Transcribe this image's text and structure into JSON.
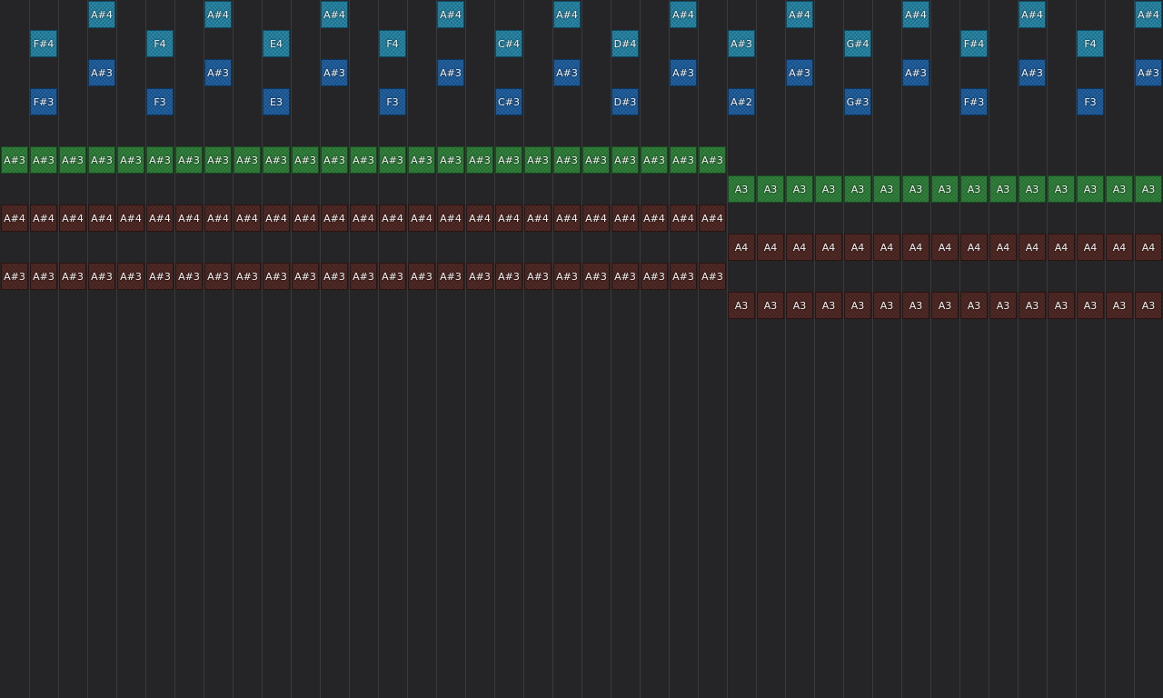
{
  "palette": {
    "background": "#252527",
    "grid_line": "#3a3a3d",
    "lead_high": "#1f7f9f",
    "lead_low": "#1a5a9a",
    "bass": "#2a7a35",
    "pad": "#4a2420",
    "note_text": "#f2f2f2"
  },
  "rows": [
    {
      "track": "lead-hi",
      "notes": [
        {
          "col": 3,
          "label": "A#4"
        },
        {
          "col": 7,
          "label": "A#4"
        },
        {
          "col": 11,
          "label": "A#4"
        },
        {
          "col": 15,
          "label": "A#4"
        },
        {
          "col": 19,
          "label": "A#4"
        },
        {
          "col": 23,
          "label": "A#4"
        },
        {
          "col": 27,
          "label": "A#4"
        },
        {
          "col": 31,
          "label": "A#4"
        },
        {
          "col": 35,
          "label": "A#4"
        },
        {
          "col": 39,
          "label": "A#4"
        }
      ]
    },
    {
      "track": "lead-hi",
      "notes": [
        {
          "col": 1,
          "label": "F#4"
        },
        {
          "col": 5,
          "label": "F4"
        },
        {
          "col": 9,
          "label": "E4"
        },
        {
          "col": 13,
          "label": "F4"
        },
        {
          "col": 17,
          "label": "C#4"
        },
        {
          "col": 21,
          "label": "D#4"
        },
        {
          "col": 25,
          "label": "A#3"
        },
        {
          "col": 29,
          "label": "G#4"
        },
        {
          "col": 33,
          "label": "F#4"
        },
        {
          "col": 37,
          "label": "F4"
        }
      ]
    },
    {
      "track": "lead-lo",
      "notes": [
        {
          "col": 3,
          "label": "A#3"
        },
        {
          "col": 7,
          "label": "A#3"
        },
        {
          "col": 11,
          "label": "A#3"
        },
        {
          "col": 15,
          "label": "A#3"
        },
        {
          "col": 19,
          "label": "A#3"
        },
        {
          "col": 23,
          "label": "A#3"
        },
        {
          "col": 27,
          "label": "A#3"
        },
        {
          "col": 31,
          "label": "A#3"
        },
        {
          "col": 35,
          "label": "A#3"
        },
        {
          "col": 39,
          "label": "A#3"
        }
      ]
    },
    {
      "track": "lead-lo",
      "notes": [
        {
          "col": 1,
          "label": "F#3"
        },
        {
          "col": 5,
          "label": "F3"
        },
        {
          "col": 9,
          "label": "E3"
        },
        {
          "col": 13,
          "label": "F3"
        },
        {
          "col": 17,
          "label": "C#3"
        },
        {
          "col": 21,
          "label": "D#3"
        },
        {
          "col": 25,
          "label": "A#2"
        },
        {
          "col": 29,
          "label": "G#3"
        },
        {
          "col": 33,
          "label": "F#3"
        },
        {
          "col": 37,
          "label": "F3"
        }
      ]
    },
    {
      "track": "empty",
      "notes": []
    },
    {
      "track": "bass",
      "run": {
        "start": 0,
        "count": 25,
        "label": "A#3"
      }
    },
    {
      "track": "bass",
      "run": {
        "start": 25,
        "count": 15,
        "label": "A3"
      }
    },
    {
      "track": "pad",
      "run": {
        "start": 0,
        "count": 25,
        "label": "A#4"
      }
    },
    {
      "track": "pad",
      "run": {
        "start": 25,
        "count": 15,
        "label": "A4"
      }
    },
    {
      "track": "pad",
      "run": {
        "start": 0,
        "count": 25,
        "label": "A#3"
      }
    },
    {
      "track": "pad",
      "run": {
        "start": 25,
        "count": 15,
        "label": "A3"
      }
    }
  ]
}
